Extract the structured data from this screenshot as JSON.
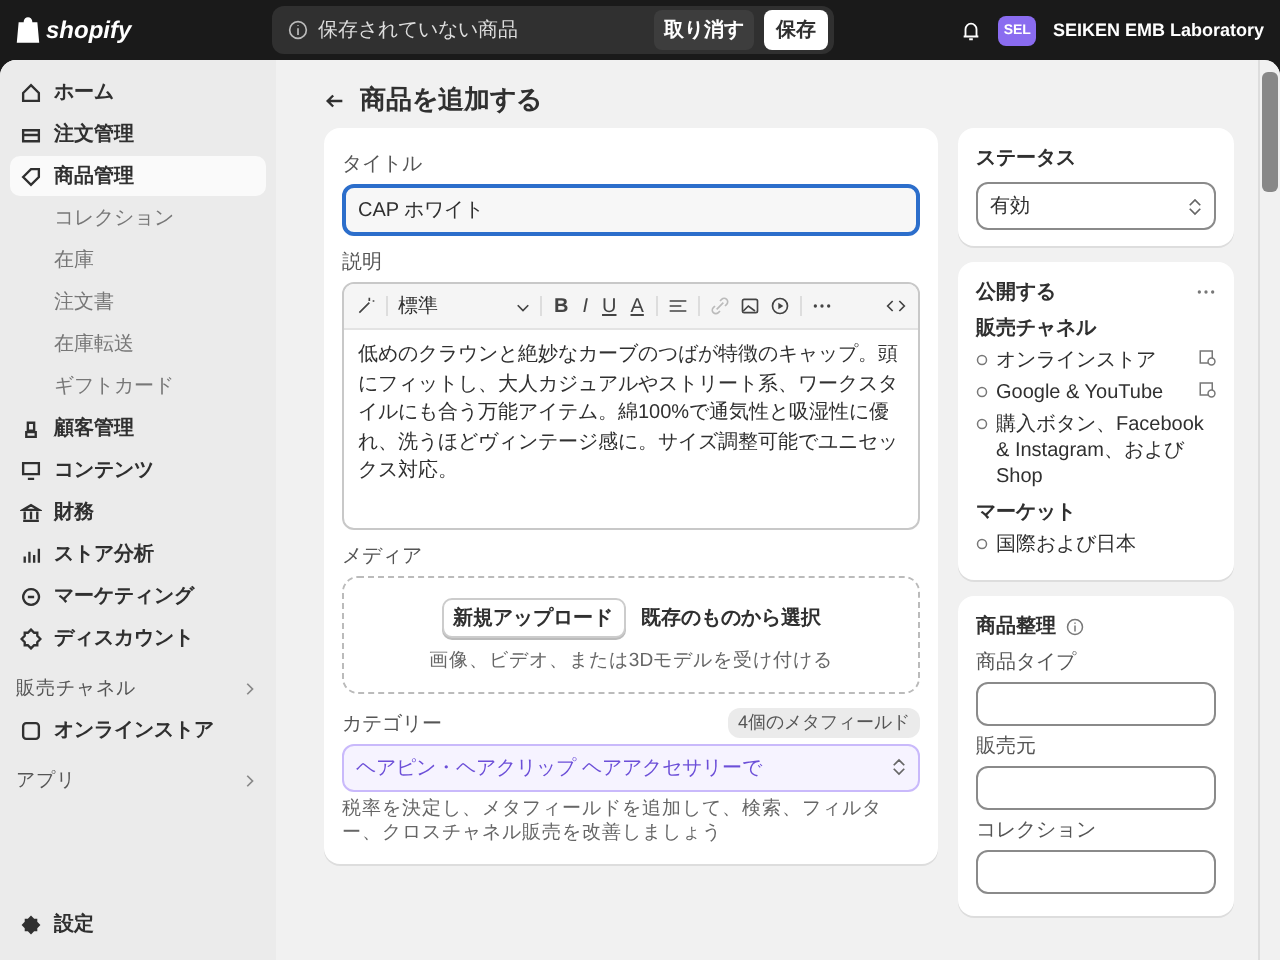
{
  "topbar": {
    "logo_text": "shopify",
    "unsaved_message": "保存されていない商品",
    "discard_button": "取り消す",
    "save_button": "保存",
    "account": {
      "initials": "SEL",
      "name": "SEIKEN EMB Laboratory"
    }
  },
  "sidebar": {
    "items": [
      {
        "label": "ホーム",
        "selected": false
      },
      {
        "label": "注文管理",
        "selected": false
      },
      {
        "label": "商品管理",
        "selected": true,
        "children": [
          {
            "label": "コレクション"
          },
          {
            "label": "在庫"
          },
          {
            "label": "注文書"
          },
          {
            "label": "在庫転送"
          },
          {
            "label": "ギフトカード"
          }
        ]
      },
      {
        "label": "顧客管理",
        "selected": false
      },
      {
        "label": "コンテンツ",
        "selected": false
      },
      {
        "label": "財務",
        "selected": false
      },
      {
        "label": "ストア分析",
        "selected": false
      },
      {
        "label": "マーケティング",
        "selected": false
      },
      {
        "label": "ディスカウント",
        "selected": false
      }
    ],
    "sections": [
      {
        "title": "販売チャネル",
        "items": [
          {
            "label": "オンラインストア",
            "selected": false
          }
        ]
      },
      {
        "title": "アプリ"
      }
    ],
    "settings": "設定"
  },
  "page_title": "商品を追加する",
  "product": {
    "title_field": {
      "label": "タイトル",
      "value": "CAP ホワイト",
      "focused": true
    },
    "description": {
      "label": "説明",
      "format": "標準",
      "marks": [
        "B",
        "I",
        "U",
        "A"
      ],
      "text": "低めのクラウンと絶妙なカーブのつばが特徴のキャップ。頭にフィットし、大人カジュアルやストリート系、ワークスタイルにも合う万能アイテム。綿100%で通気性と吸湿性に優れ、洗うほどヴィンテージ感に。サイズ調整可能でユニセックス対応。"
    },
    "media": {
      "label": "メディア",
      "upload_button": "新規アップロード",
      "select_link": "既存のものから選択",
      "hint": "画像、ビデオ、または3Dモデルを受け付ける"
    },
    "category": {
      "label": "カテゴリー",
      "badge": "4個のメタフィールド",
      "value": "ヘアピン・ヘアクリップ ヘアアクセサリーで",
      "hint": "税率を決定し、メタフィールドを追加して、検索、フィルター、クロスチャネル販売を改善しましょう"
    }
  },
  "status": {
    "label": "ステータス",
    "value": "有効"
  },
  "publishing": {
    "title": "公開する",
    "channels_title": "販売チャネル",
    "channels": [
      {
        "label": "オンラインストア",
        "scheduled": true
      },
      {
        "label": "Google & YouTube",
        "scheduled": true
      },
      {
        "label": "購入ボタン、Facebook & Instagram、およびShop",
        "scheduled": false
      }
    ],
    "markets_title": "マーケット",
    "markets": [
      {
        "label": "国際および日本"
      }
    ]
  },
  "organization": {
    "title": "商品整理",
    "fields": [
      {
        "label": "商品タイプ"
      },
      {
        "label": "販売元"
      },
      {
        "label": "コレクション"
      }
    ]
  }
}
